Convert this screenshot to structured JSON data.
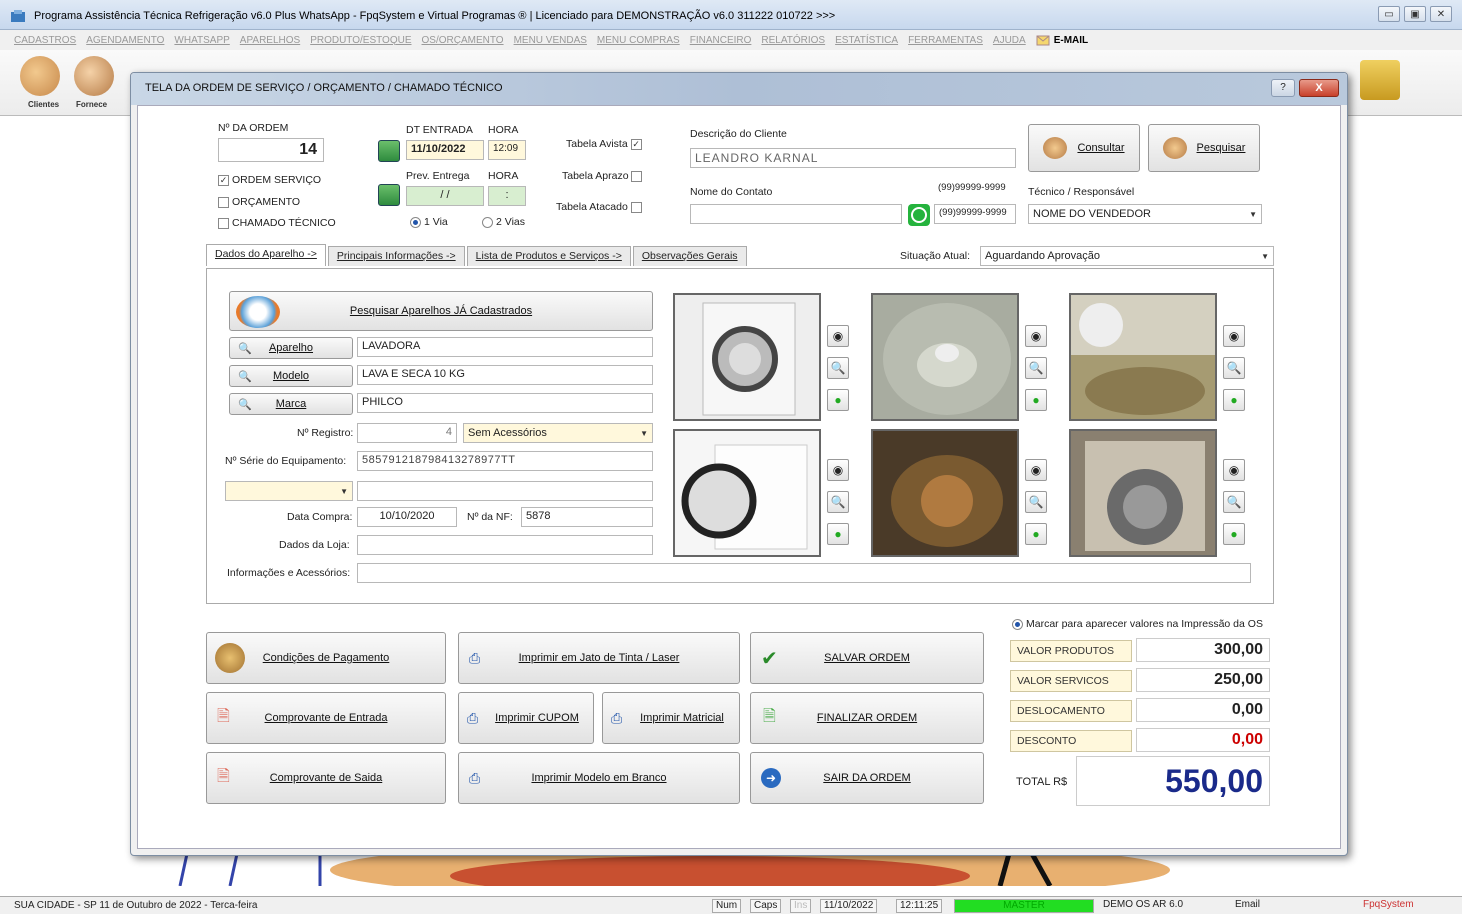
{
  "app": {
    "title": "Programa Assistência Técnica Refrigeração v6.0 Plus WhatsApp - FpqSystem e Virtual Programas ® | Licenciado para  DEMONSTRAÇÃO v6.0 311222 010722 >>>",
    "menu": [
      "CADASTROS",
      "AGENDAMENTO",
      "WHATSAPP",
      "APARELHOS",
      "PRODUTO/ESTOQUE",
      "OS/ORÇAMENTO",
      "MENU VENDAS",
      "MENU COMPRAS",
      "FINANCEIRO",
      "RELATÓRIOS",
      "ESTATÍSTICA",
      "FERRAMENTAS",
      "AJUDA"
    ],
    "menu_email": "E-MAIL",
    "toolbar_labels": {
      "clientes": "Clientes",
      "fornece": "Fornece"
    }
  },
  "dialog": {
    "title": "TELA DA ORDEM DE SERVIÇO / ORÇAMENTO / CHAMADO TÉCNICO",
    "help": "?",
    "close": "X",
    "order": {
      "number_label": "Nº DA ORDEM",
      "number_value": "14",
      "types": [
        {
          "label": "ORDEM SERVIÇO",
          "checked": true
        },
        {
          "label": "ORÇAMENTO",
          "checked": false
        },
        {
          "label": "CHAMADO TÉCNICO",
          "checked": false
        }
      ]
    },
    "dates": {
      "entry_label": "DT ENTRADA",
      "hour_label": "HORA",
      "entry_date": "11/10/2022",
      "entry_hour": "12:09",
      "delivery_label": "Prev. Entrega",
      "delivery_hour_label": "HORA",
      "delivery_date": "/ /",
      "delivery_hour": ":",
      "copies": [
        {
          "label": "1 Via",
          "on": true
        },
        {
          "label": "2 Vias",
          "on": false
        }
      ]
    },
    "tables": [
      {
        "label": "Tabela Avista",
        "checked": true
      },
      {
        "label": "Tabela Aprazo",
        "checked": false
      },
      {
        "label": "Tabela Atacado",
        "checked": false
      }
    ],
    "client": {
      "desc_label": "Descrição do Cliente",
      "name": "LEANDRO KARNAL",
      "contact_label": "Nome do Contato",
      "contact": "",
      "phone1": "(99)99999-9999",
      "phone2": "(99)99999-9999",
      "consult_btn": "Consultar",
      "search_btn": "Pesquisar",
      "tech_label": "Técnico / Responsável",
      "tech_value": "NOME DO VENDEDOR"
    },
    "tabs": [
      "Dados do Aparelho ->",
      "Principais Informações ->",
      "Lista de Produtos e Serviços ->",
      "Observações Gerais"
    ],
    "status_label": "Situação Atual:",
    "status_value": "Aguardando Aprovação",
    "device": {
      "search_btn": "Pesquisar Aparelhos JÁ Cadastrados",
      "fields": [
        {
          "btn": "Aparelho",
          "value": "LAVADORA"
        },
        {
          "btn": "Modelo",
          "value": "LAVA E SECA 10 KG"
        },
        {
          "btn": "Marca",
          "value": "PHILCO"
        }
      ],
      "reg_label": "Nº Registro:",
      "reg_value": "4",
      "accessories": "Sem Acessórios",
      "serial_label": "Nº Série do Equipamento:",
      "serial_value": "585791218798413278977TT",
      "extra_select": "",
      "extra_value": "",
      "purchase_label": "Data Compra:",
      "purchase_value": "10/10/2020",
      "nf_label": "Nº da NF:",
      "nf_value": "5878",
      "store_label": "Dados da Loja:",
      "store_value": "",
      "info_label": "Informações e Acessórios:",
      "info_value": ""
    },
    "actions": {
      "payment": "Condições de Pagamento",
      "entry_receipt": "Comprovante de Entrada",
      "exit_receipt": "Comprovante de Saida",
      "print_laser": "Imprimir em Jato de Tinta / Laser",
      "print_cupom": "Imprimir CUPOM",
      "print_matricial": "Imprimir Matricial",
      "print_blank": "Imprimir Modelo em Branco",
      "save": "SALVAR ORDEM",
      "finish": "FINALIZAR ORDEM",
      "exit": "SAIR DA ORDEM"
    },
    "values": {
      "show_label": "Marcar para aparecer valores na Impressão da OS",
      "rows": [
        {
          "label": "VALOR PRODUTOS",
          "value": "300,00",
          "color": "#111111"
        },
        {
          "label": "VALOR SERVICOS",
          "value": "250,00",
          "color": "#111111"
        },
        {
          "label": "DESLOCAMENTO",
          "value": "0,00",
          "color": "#111111"
        },
        {
          "label": "DESCONTO",
          "value": "0,00",
          "color": "#cc0000"
        }
      ],
      "total_label": "TOTAL R$",
      "total_value": "550,00",
      "total_color": "#1a2a8a"
    }
  },
  "statusbar": {
    "left": "SUA CIDADE - SP 11 de Outubro de 2022 - Terca-feira",
    "num": "Num",
    "caps": "Caps",
    "ins": "Ins",
    "date": "11/10/2022",
    "time": "12:11:25",
    "user": "MASTER",
    "demo": "DEMO OS AR 6.0",
    "email": "Email",
    "brand": "FpqSystem"
  }
}
